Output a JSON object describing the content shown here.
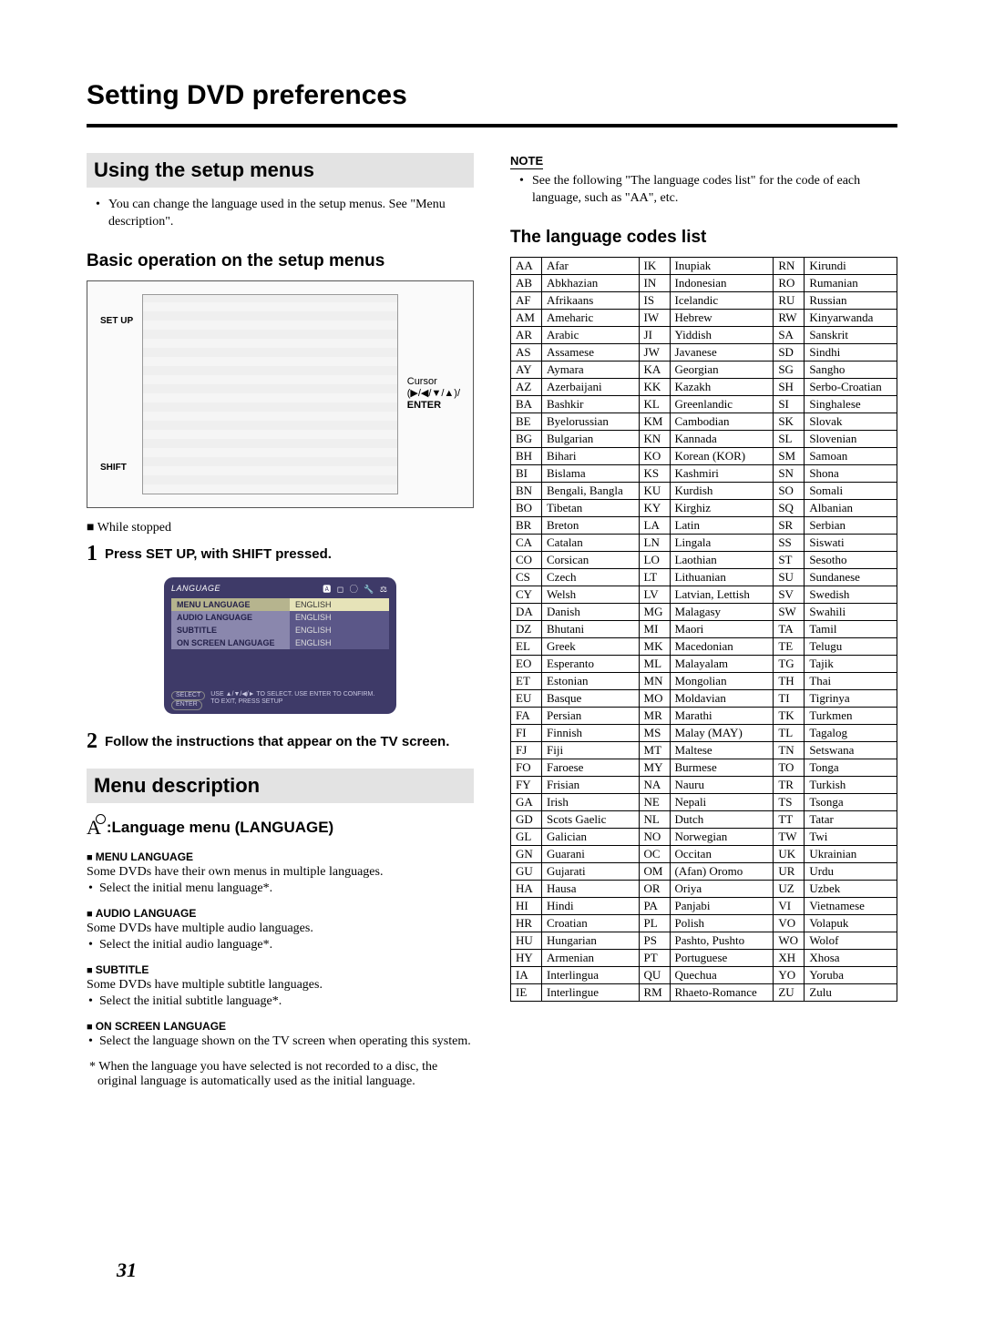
{
  "title": "Setting DVD preferences",
  "page_number": "31",
  "left": {
    "section1_title": "Using the setup menus",
    "section1_bullet": "You can change the language used in the setup menus. See \"Menu description\".",
    "subheading1": "Basic operation on the setup menus",
    "remote": {
      "label_setup": "SET UP",
      "label_shift": "SHIFT",
      "label_cursor": "Cursor",
      "label_cursor_keys": "(▶/◀/▼/▲)/",
      "label_enter": "ENTER"
    },
    "state": "■ While stopped",
    "step1_num": "1",
    "step1_text": "Press SET UP, with SHIFT pressed.",
    "osd": {
      "title": "LANGUAGE",
      "icons": "🅰 ◻ ◯ 🔧 ⚖",
      "rows": [
        {
          "label": "MENU LANGUAGE",
          "value": "ENGLISH",
          "selected": true
        },
        {
          "label": "AUDIO LANGUAGE",
          "value": "ENGLISH",
          "selected": false
        },
        {
          "label": "SUBTITLE",
          "value": "ENGLISH",
          "selected": false
        },
        {
          "label": "ON SCREEN LANGUAGE",
          "value": "ENGLISH",
          "selected": false
        }
      ],
      "footer_select": "SELECT",
      "footer_enter": "ENTER",
      "footer_hint1": "USE ▲/▼/◀/► TO SELECT. USE ENTER TO CONFIRM.",
      "footer_hint2": "TO EXIT, PRESS SETUP"
    },
    "step2_num": "2",
    "step2_text": "Follow the instructions that appear on the TV screen.",
    "section2_title": "Menu description",
    "lang_menu_heading": ":Language menu (LANGUAGE)",
    "options": [
      {
        "title": "MENU LANGUAGE",
        "desc": "Some DVDs have their own menus in multiple languages.",
        "bullet": "Select the initial menu language*."
      },
      {
        "title": "AUDIO LANGUAGE",
        "desc": "Some DVDs have multiple audio languages.",
        "bullet": "Select the initial audio language*."
      },
      {
        "title": "SUBTITLE",
        "desc": "Some DVDs have multiple subtitle languages.",
        "bullet": "Select the initial subtitle language*."
      },
      {
        "title": "ON SCREEN LANGUAGE",
        "desc": "",
        "bullet": "Select the language shown on the TV screen when operating this system."
      }
    ],
    "footnote": "* When the language you have selected is not recorded to a disc, the original language is automatically used as the initial language."
  },
  "right": {
    "note_label": "NOTE",
    "note_text": "See the following \"The language codes list\" for the code of each language, such as \"AA\", etc.",
    "list_heading": "The language codes list",
    "codes": [
      [
        "AA",
        "Afar",
        "IK",
        "Inupiak",
        "RN",
        "Kirundi"
      ],
      [
        "AB",
        "Abkhazian",
        "IN",
        "Indonesian",
        "RO",
        "Rumanian"
      ],
      [
        "AF",
        "Afrikaans",
        "IS",
        "Icelandic",
        "RU",
        "Russian"
      ],
      [
        "AM",
        "Ameharic",
        "IW",
        "Hebrew",
        "RW",
        "Kinyarwanda"
      ],
      [
        "AR",
        "Arabic",
        "JI",
        "Yiddish",
        "SA",
        "Sanskrit"
      ],
      [
        "AS",
        "Assamese",
        "JW",
        "Javanese",
        "SD",
        "Sindhi"
      ],
      [
        "AY",
        "Aymara",
        "KA",
        "Georgian",
        "SG",
        "Sangho"
      ],
      [
        "AZ",
        "Azerbaijani",
        "KK",
        "Kazakh",
        "SH",
        "Serbo-Croatian"
      ],
      [
        "BA",
        "Bashkir",
        "KL",
        "Greenlandic",
        "SI",
        "Singhalese"
      ],
      [
        "BE",
        "Byelorussian",
        "KM",
        "Cambodian",
        "SK",
        "Slovak"
      ],
      [
        "BG",
        "Bulgarian",
        "KN",
        "Kannada",
        "SL",
        "Slovenian"
      ],
      [
        "BH",
        "Bihari",
        "KO",
        "Korean (KOR)",
        "SM",
        "Samoan"
      ],
      [
        "BI",
        "Bislama",
        "KS",
        "Kashmiri",
        "SN",
        "Shona"
      ],
      [
        "BN",
        "Bengali, Bangla",
        "KU",
        "Kurdish",
        "SO",
        "Somali"
      ],
      [
        "BO",
        "Tibetan",
        "KY",
        "Kirghiz",
        "SQ",
        "Albanian"
      ],
      [
        "BR",
        "Breton",
        "LA",
        "Latin",
        "SR",
        "Serbian"
      ],
      [
        "CA",
        "Catalan",
        "LN",
        "Lingala",
        "SS",
        "Siswati"
      ],
      [
        "CO",
        "Corsican",
        "LO",
        "Laothian",
        "ST",
        "Sesotho"
      ],
      [
        "CS",
        "Czech",
        "LT",
        "Lithuanian",
        "SU",
        "Sundanese"
      ],
      [
        "CY",
        "Welsh",
        "LV",
        "Latvian, Lettish",
        "SV",
        "Swedish"
      ],
      [
        "DA",
        "Danish",
        "MG",
        "Malagasy",
        "SW",
        "Swahili"
      ],
      [
        "DZ",
        "Bhutani",
        "MI",
        "Maori",
        "TA",
        "Tamil"
      ],
      [
        "EL",
        "Greek",
        "MK",
        "Macedonian",
        "TE",
        "Telugu"
      ],
      [
        "EO",
        "Esperanto",
        "ML",
        "Malayalam",
        "TG",
        "Tajik"
      ],
      [
        "ET",
        "Estonian",
        "MN",
        "Mongolian",
        "TH",
        "Thai"
      ],
      [
        "EU",
        "Basque",
        "MO",
        "Moldavian",
        "TI",
        "Tigrinya"
      ],
      [
        "FA",
        "Persian",
        "MR",
        "Marathi",
        "TK",
        "Turkmen"
      ],
      [
        "FI",
        "Finnish",
        "MS",
        "Malay (MAY)",
        "TL",
        "Tagalog"
      ],
      [
        "FJ",
        "Fiji",
        "MT",
        "Maltese",
        "TN",
        "Setswana"
      ],
      [
        "FO",
        "Faroese",
        "MY",
        "Burmese",
        "TO",
        "Tonga"
      ],
      [
        "FY",
        "Frisian",
        "NA",
        "Nauru",
        "TR",
        "Turkish"
      ],
      [
        "GA",
        "Irish",
        "NE",
        "Nepali",
        "TS",
        "Tsonga"
      ],
      [
        "GD",
        "Scots Gaelic",
        "NL",
        "Dutch",
        "TT",
        "Tatar"
      ],
      [
        "GL",
        "Galician",
        "NO",
        "Norwegian",
        "TW",
        "Twi"
      ],
      [
        "GN",
        "Guarani",
        "OC",
        "Occitan",
        "UK",
        "Ukrainian"
      ],
      [
        "GU",
        "Gujarati",
        "OM",
        "(Afan) Oromo",
        "UR",
        "Urdu"
      ],
      [
        "HA",
        "Hausa",
        "OR",
        "Oriya",
        "UZ",
        "Uzbek"
      ],
      [
        "HI",
        "Hindi",
        "PA",
        "Panjabi",
        "VI",
        "Vietnamese"
      ],
      [
        "HR",
        "Croatian",
        "PL",
        "Polish",
        "VO",
        "Volapuk"
      ],
      [
        "HU",
        "Hungarian",
        "PS",
        "Pashto, Pushto",
        "WO",
        "Wolof"
      ],
      [
        "HY",
        "Armenian",
        "PT",
        "Portuguese",
        "XH",
        "Xhosa"
      ],
      [
        "IA",
        "Interlingua",
        "QU",
        "Quechua",
        "YO",
        "Yoruba"
      ],
      [
        "IE",
        "Interlingue",
        "RM",
        "Rhaeto-Romance",
        "ZU",
        "Zulu"
      ]
    ]
  }
}
